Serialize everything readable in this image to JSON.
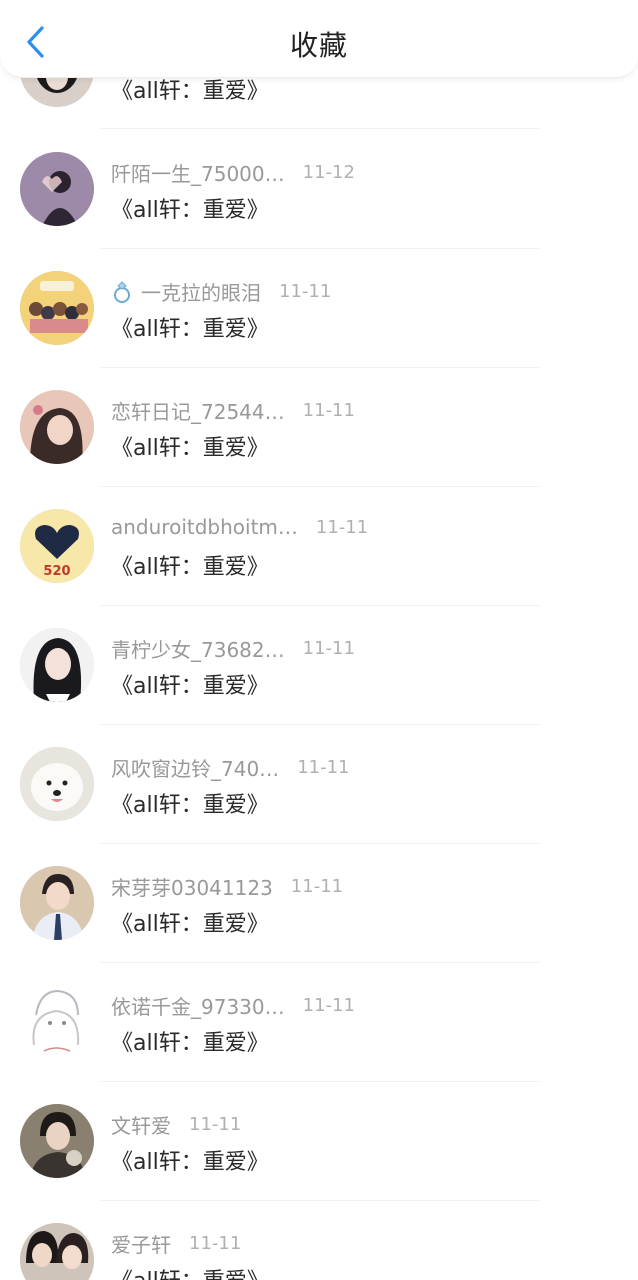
{
  "header": {
    "title": "收藏"
  },
  "posts": [
    {
      "name": "",
      "date": "",
      "content": "《all轩：重爱》",
      "avatar": "dark-portrait"
    },
    {
      "name": "阡陌一生_75000…",
      "date": "11-12",
      "content": "《all轩：重爱》",
      "avatar": "purple-heart-hands"
    },
    {
      "name": "一克拉的眼泪",
      "date": "11-11",
      "content": "《all轩：重爱》",
      "avatar": "yellow-group-cartoon",
      "name_icon": "diamond-ring-icon"
    },
    {
      "name": "恋轩日记_72544…",
      "date": "11-11",
      "content": "《all轩：重爱》",
      "avatar": "girl-peach"
    },
    {
      "name": "anduroitdbhoitm…",
      "date": "11-11",
      "content": "《all轩：重爱》",
      "avatar": "pixel-heart-520"
    },
    {
      "name": "青柠少女_73682…",
      "date": "11-11",
      "content": "《all轩：重爱》",
      "avatar": "anime-girl"
    },
    {
      "name": "风吹窗边铃_740…",
      "date": "11-11",
      "content": "《all轩：重爱》",
      "avatar": "white-dog"
    },
    {
      "name": "宋芽芽03041123",
      "date": "11-11",
      "content": "《all轩：重爱》",
      "avatar": "boy-suit"
    },
    {
      "name": "依诺千金_97330…",
      "date": "11-11",
      "content": "《all轩：重爱》",
      "avatar": "sketch-girl"
    },
    {
      "name": "文轩爱",
      "date": "11-11",
      "content": "《all轩：重爱》",
      "avatar": "boy-dark"
    },
    {
      "name": "爱子轩",
      "date": "11-11",
      "content": "《all轩：重爱》",
      "avatar": "couple-photo"
    }
  ],
  "avatar_text": {
    "pixel-heart-520": "520"
  },
  "colors": {
    "accent": "#2b8ef0",
    "name": "#999999",
    "date": "#b0b0b0",
    "content": "#2a2a2a"
  }
}
